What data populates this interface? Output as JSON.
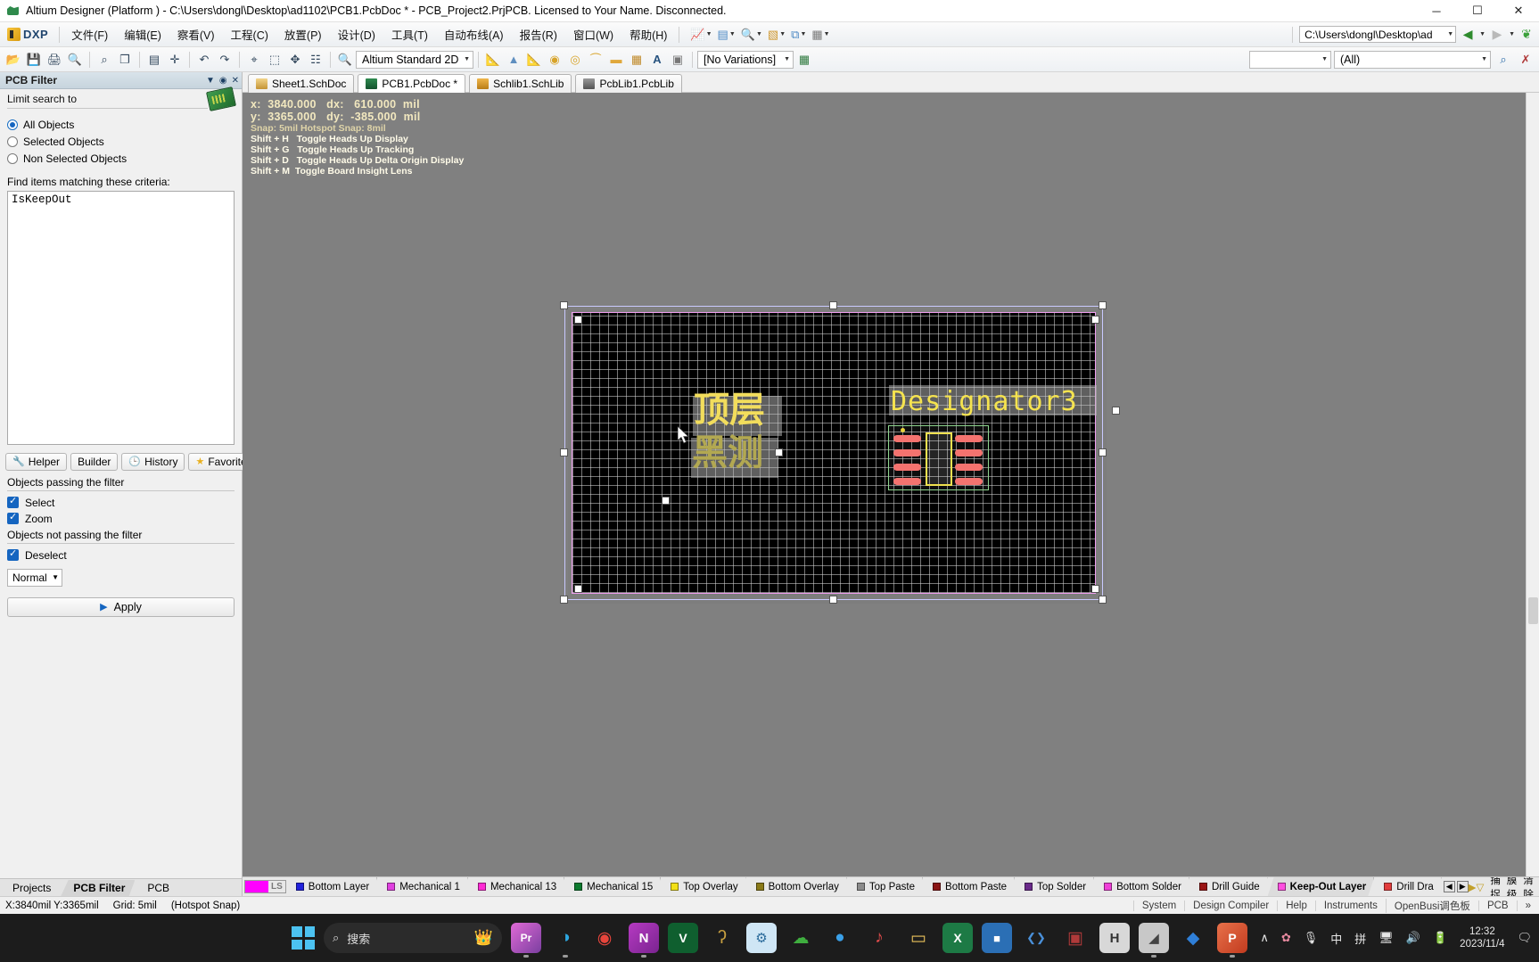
{
  "window": {
    "title": "Altium Designer (Platform ) - C:\\Users\\dongl\\Desktop\\ad1102\\PCB1.PcbDoc * - PCB_Project2.PrjPCB. Licensed to Your Name. Disconnected.",
    "minimize": "─",
    "maximize": "☐",
    "close": "✕"
  },
  "menubar": {
    "dxp_label": "DXP",
    "items": [
      {
        "label": "文件(F)"
      },
      {
        "label": "编辑(E)"
      },
      {
        "label": "察看(V)"
      },
      {
        "label": "工程(C)"
      },
      {
        "label": "放置(P)"
      },
      {
        "label": "设计(D)"
      },
      {
        "label": "工具(T)"
      },
      {
        "label": "自动布线(A)"
      },
      {
        "label": "报告(R)"
      },
      {
        "label": "窗口(W)"
      },
      {
        "label": "帮助(H)"
      }
    ],
    "icon_buttons": [
      {
        "name": "route-icon",
        "glyph": "📈"
      },
      {
        "name": "document-icon",
        "glyph": "⬜"
      },
      {
        "name": "find-icon",
        "glyph": "🔍"
      },
      {
        "name": "ruler-icon",
        "glyph": "◧"
      },
      {
        "name": "layers-icon",
        "glyph": "⧉"
      },
      {
        "name": "grid-icon",
        "glyph": "▦"
      }
    ],
    "path_value": "C:\\Users\\dongl\\Desktop\\ad",
    "nav_back": "◀",
    "nav_forward": "▶"
  },
  "toolbar": {
    "view_config": "Altium Standard 2D",
    "variations": "[No Variations]",
    "icons": [
      {
        "name": "open-document-icon",
        "glyph": "📂"
      },
      {
        "name": "save-icon",
        "glyph": "💾"
      },
      {
        "name": "print-icon",
        "glyph": "🖨"
      },
      {
        "name": "print-preview-icon",
        "glyph": "🔎"
      },
      {
        "name": "zoom-area-icon",
        "glyph": "⌕"
      },
      {
        "name": "zoom-window-icon",
        "glyph": "❐"
      },
      {
        "name": "board-icon",
        "glyph": "▤"
      },
      {
        "name": "pan-icon",
        "glyph": "✛"
      },
      {
        "name": "undo-icon",
        "glyph": "↶"
      },
      {
        "name": "redo-icon",
        "glyph": "↷"
      },
      {
        "name": "cross-probe-icon",
        "glyph": "⌖"
      },
      {
        "name": "select-icon",
        "glyph": "⬚"
      },
      {
        "name": "move-icon",
        "glyph": "✥"
      },
      {
        "name": "browse-icon",
        "glyph": "☷"
      }
    ],
    "place_icons": [
      {
        "name": "place-track-icon",
        "glyph": "📐"
      },
      {
        "name": "place-via-icon",
        "glyph": "◉"
      },
      {
        "name": "place-pad-icon",
        "glyph": "☉"
      },
      {
        "name": "place-arc-icon",
        "glyph": "◜"
      },
      {
        "name": "place-fill-icon",
        "glyph": "▬"
      },
      {
        "name": "place-polygon-icon",
        "glyph": "▦"
      },
      {
        "name": "place-string-icon",
        "glyph": "A"
      },
      {
        "name": "place-component-icon",
        "glyph": "▣"
      }
    ],
    "filter_dropdown_value": "",
    "scope_value": "(All)",
    "clear_filter_icon": "✗",
    "apply_filter_icon": "✔"
  },
  "left_panel": {
    "header_title": "PCB Filter",
    "header_tools": [
      "▼",
      "◉",
      "✕"
    ],
    "limit_label": "Limit search to",
    "radios": [
      {
        "label": "All Objects",
        "selected": true
      },
      {
        "label": "Selected Objects",
        "selected": false
      },
      {
        "label": "Non Selected Objects",
        "selected": false
      }
    ],
    "criteria_label": "Find items matching these criteria:",
    "criteria_value": "IsKeepOut",
    "mini_tabs": [
      {
        "label": "Helper",
        "icon": "🔧"
      },
      {
        "label": "Builder",
        "icon": ""
      },
      {
        "label": "History",
        "icon": "🕒"
      },
      {
        "label": "Favorites",
        "icon": "★"
      }
    ],
    "tab_overflow": "⋮",
    "pass_label": "Objects passing the filter",
    "pass_options": [
      {
        "label": "Select",
        "checked": true
      },
      {
        "label": "Zoom",
        "checked": true
      }
    ],
    "fail_label": "Objects not passing the filter",
    "fail_options": [
      {
        "label": "Deselect",
        "checked": true
      }
    ],
    "mode_value": "Normal",
    "apply_label": "Apply",
    "bottom_tabs": [
      {
        "label": "Projects",
        "selected": false
      },
      {
        "label": "PCB Filter",
        "selected": true
      },
      {
        "label": "PCB",
        "selected": false
      }
    ]
  },
  "doc_tabs": [
    {
      "label": "Sheet1.SchDoc",
      "active": false,
      "color": "#d9b45a"
    },
    {
      "label": "PCB1.PcbDoc *",
      "active": true,
      "color": "#1d6b3c"
    },
    {
      "label": "Schlib1.SchLib",
      "active": false,
      "color": "#e0a33c"
    },
    {
      "label": "PcbLib1.PcbLib",
      "active": false,
      "color": "#707070"
    }
  ],
  "hud": {
    "line1": "x:  3840.000   dx:   610.000  mil",
    "line2": "y:  3365.000   dy:  -385.000  mil",
    "line3": "Snap: 5mil Hotspot Snap: 8mil",
    "shortcuts": [
      "Shift + H   Toggle Heads Up Display",
      "Shift + G   Toggle Heads Up Tracking",
      "Shift + D   Toggle Heads Up Delta Origin Display",
      "Shift + M  Toggle Board Insight Lens"
    ]
  },
  "canvas": {
    "top_layer_text": "顶层",
    "second_text": "黑测",
    "designator_text": "Designator3"
  },
  "layer_tabs": {
    "ls_label": "LS",
    "ls_color": "#ff00ff",
    "tabs": [
      {
        "label": "Bottom Layer",
        "color": "#2222dd",
        "active": false
      },
      {
        "label": "Mechanical 1",
        "color": "#e040e0",
        "active": false
      },
      {
        "label": "Mechanical 13",
        "color": "#ff2ad4",
        "active": false
      },
      {
        "label": "Mechanical 15",
        "color": "#0c7a2e",
        "active": false
      },
      {
        "label": "Top Overlay",
        "color": "#f2e017",
        "active": false
      },
      {
        "label": "Bottom Overlay",
        "color": "#8a7a18",
        "active": false
      },
      {
        "label": "Top Paste",
        "color": "#8b8b8b",
        "active": false
      },
      {
        "label": "Bottom Paste",
        "color": "#8a1515",
        "active": false
      },
      {
        "label": "Top Solder",
        "color": "#6a2a8a",
        "active": false
      },
      {
        "label": "Bottom Solder",
        "color": "#ef3fd8",
        "active": false
      },
      {
        "label": "Drill Guide",
        "color": "#9a1414",
        "active": false
      },
      {
        "label": "Keep-Out Layer",
        "color": "#ff4fe0",
        "active": true
      },
      {
        "label": "Drill Dra",
        "color": "#e23c3c",
        "active": false
      }
    ],
    "arrows": [
      "◀",
      "▶"
    ],
    "right_items": [
      "⚡",
      "▶▽",
      "捕捉",
      "掩膜级别",
      "清除"
    ]
  },
  "statusbar": {
    "coords": "X:3840mil Y:3365mil",
    "grid": "Grid: 5mil",
    "snap": "(Hotspot Snap)",
    "right_items": [
      "System",
      "Design Compiler",
      "Help",
      "Instruments",
      "OpenBusi调色板",
      "PCB",
      "»"
    ]
  },
  "taskbar": {
    "search_placeholder": "搜索",
    "search_icon": "⌕",
    "pill_emoji": "👑",
    "apps": [
      {
        "name": "premiere-icon",
        "glyph": "Pr",
        "color": "#e06ad6",
        "running": true
      },
      {
        "name": "edge-icon",
        "glyph": "◑",
        "color": "#2da7e0",
        "running": true
      },
      {
        "name": "chrome-icon",
        "glyph": "◉",
        "color": "#e8453c",
        "running": false
      },
      {
        "name": "onenote-icon",
        "glyph": "N",
        "color": "#b63ac2",
        "running": true
      },
      {
        "name": "vegas-icon",
        "glyph": "V",
        "color": "#0f5f2f",
        "running": false
      },
      {
        "name": "creative-icon",
        "glyph": "ʔ",
        "color": "#c8a040",
        "running": false
      },
      {
        "name": "science-icon",
        "glyph": "⚙",
        "color": "#7fc2e8",
        "running": false
      },
      {
        "name": "wechat-icon",
        "glyph": "☁",
        "color": "#3fae3f",
        "running": false
      },
      {
        "name": "qq-icon",
        "glyph": "●",
        "color": "#3aa0e8",
        "running": false
      },
      {
        "name": "music-icon",
        "glyph": "♪",
        "color": "#e04b4b",
        "running": false
      },
      {
        "name": "folder-icon",
        "glyph": "▭",
        "color": "#e8c05a",
        "running": false
      },
      {
        "name": "excel-icon",
        "glyph": "X",
        "color": "#1d7a45",
        "running": false
      },
      {
        "name": "terminal-icon",
        "glyph": "■",
        "color": "#2b6fb5",
        "running": false
      },
      {
        "name": "code-icon",
        "glyph": "❮❯",
        "color": "#4a90d9",
        "running": false
      },
      {
        "name": "store-icon",
        "glyph": "▣",
        "color": "#b03a3a",
        "running": false
      },
      {
        "name": "hdesign-icon",
        "glyph": "H",
        "color": "#d8d8d8",
        "running": false
      },
      {
        "name": "altium-icon",
        "glyph": "◢",
        "color": "#c8c8c8",
        "running": true
      },
      {
        "name": "camera-icon",
        "glyph": "◆",
        "color": "#2f7fd8",
        "running": false
      },
      {
        "name": "powerpoint-icon",
        "glyph": "P",
        "color": "#d2552f",
        "running": true
      }
    ],
    "tray": {
      "chevron": "∧",
      "flower": "✿",
      "mic": "🎙",
      "ime_lang": "中",
      "ime_mode": "拼",
      "display": "🖥",
      "volume": "🔊",
      "battery": "🔋",
      "time": "12:32",
      "date": "2023/11/4",
      "notify": "🗨"
    }
  }
}
